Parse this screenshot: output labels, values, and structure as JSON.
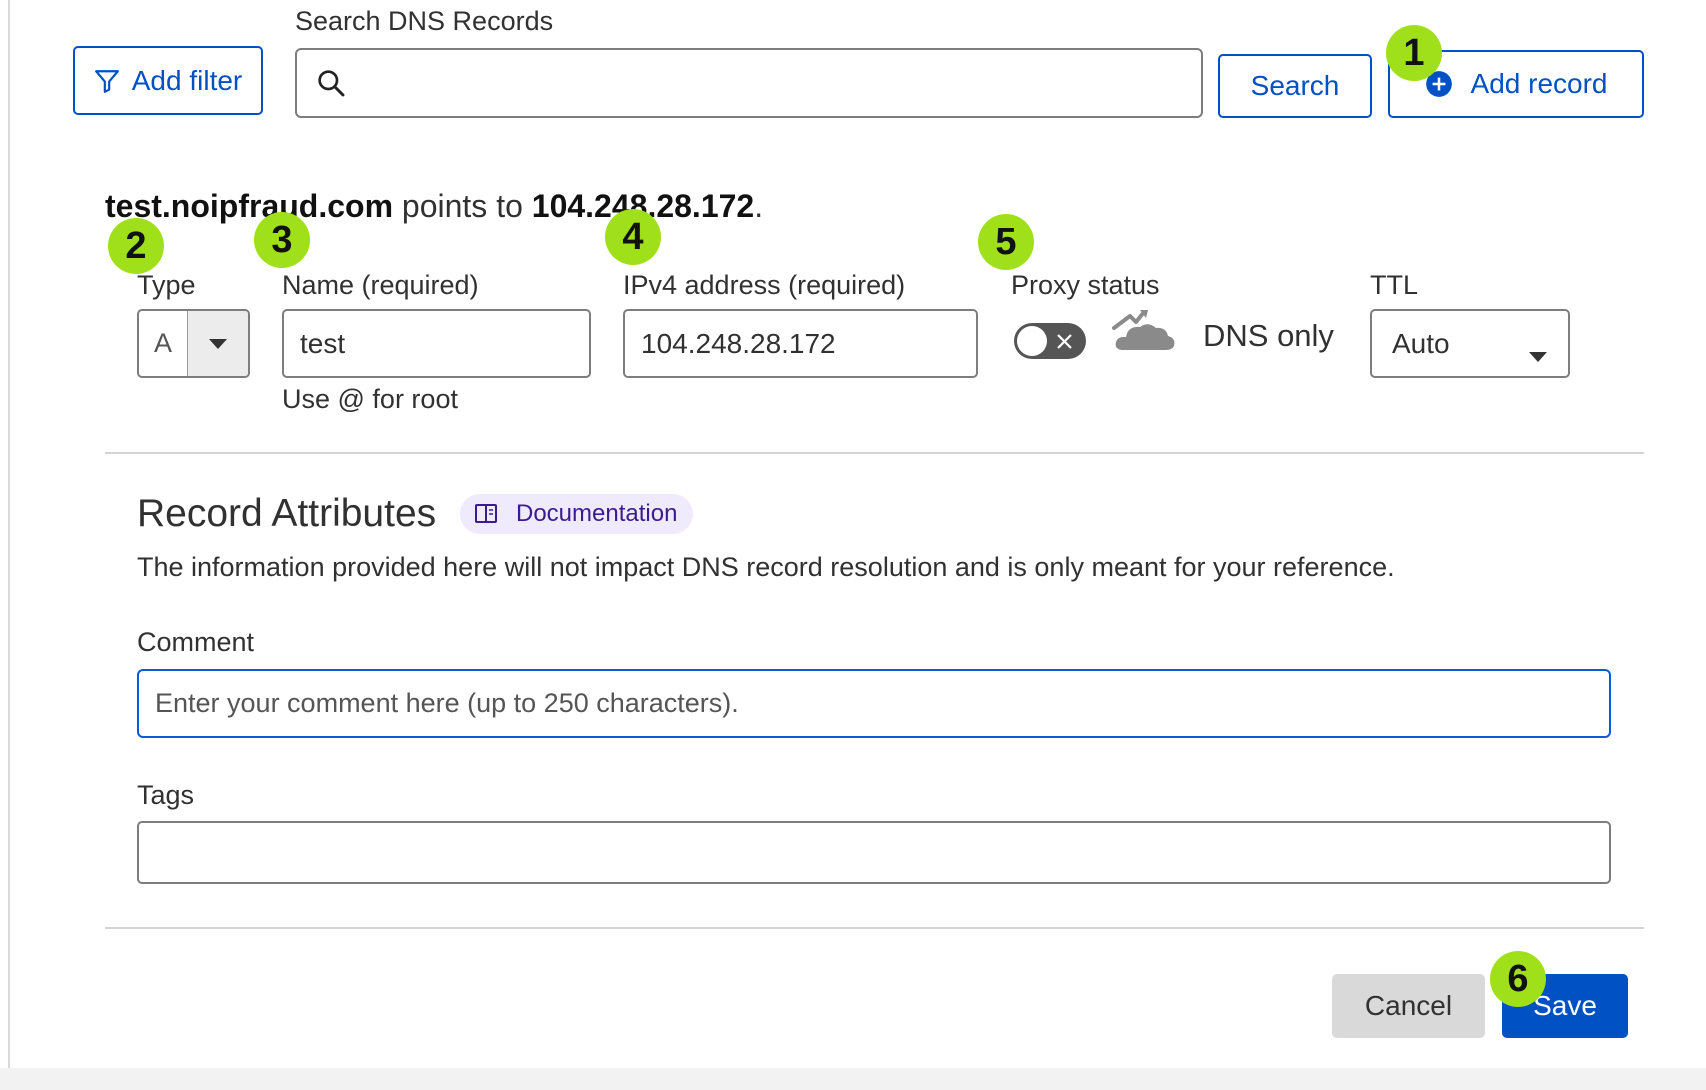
{
  "toolbar": {
    "add_filter_label": "Add filter",
    "search_label": "Search DNS Records",
    "search_value": "",
    "search_button_label": "Search",
    "add_record_label": "Add record"
  },
  "callouts": [
    "1",
    "2",
    "3",
    "4",
    "5",
    "6"
  ],
  "record_summary": {
    "hostname": "test.noipfraud.com",
    "connector": " points to ",
    "target": "104.248.28.172",
    "end": "."
  },
  "form": {
    "type_label": "Type",
    "type_value": "A",
    "name_label": "Name (required)",
    "name_value": "test",
    "name_helper": "Use @ for root",
    "ipv4_label": "IPv4 address (required)",
    "ipv4_value": "104.248.28.172",
    "proxy_label": "Proxy status",
    "proxy_status_text": "DNS only",
    "ttl_label": "TTL",
    "ttl_value": "Auto"
  },
  "attributes": {
    "title": "Record Attributes",
    "doc_link_label": "Documentation",
    "description": "The information provided here will not impact DNS record resolution and is only meant for your reference.",
    "comment_label": "Comment",
    "comment_placeholder": "Enter your comment here (up to 250 characters).",
    "comment_value": "",
    "tags_label": "Tags",
    "tags_value": ""
  },
  "actions": {
    "cancel_label": "Cancel",
    "save_label": "Save"
  },
  "colors": {
    "primary": "#0051c3",
    "callout": "#9fe01a",
    "toggle_off": "#555555",
    "doc_pill_bg": "#efeafc",
    "doc_pill_text": "#3c1b8f"
  },
  "icons": {
    "add_filter": "filter-icon",
    "search": "search-icon",
    "add_record": "plus-circle-icon",
    "type_caret": "caret-down-icon",
    "proxy_cloud": "dns-only-cloud-icon",
    "ttl_caret": "caret-down-icon",
    "documentation": "book-icon"
  }
}
